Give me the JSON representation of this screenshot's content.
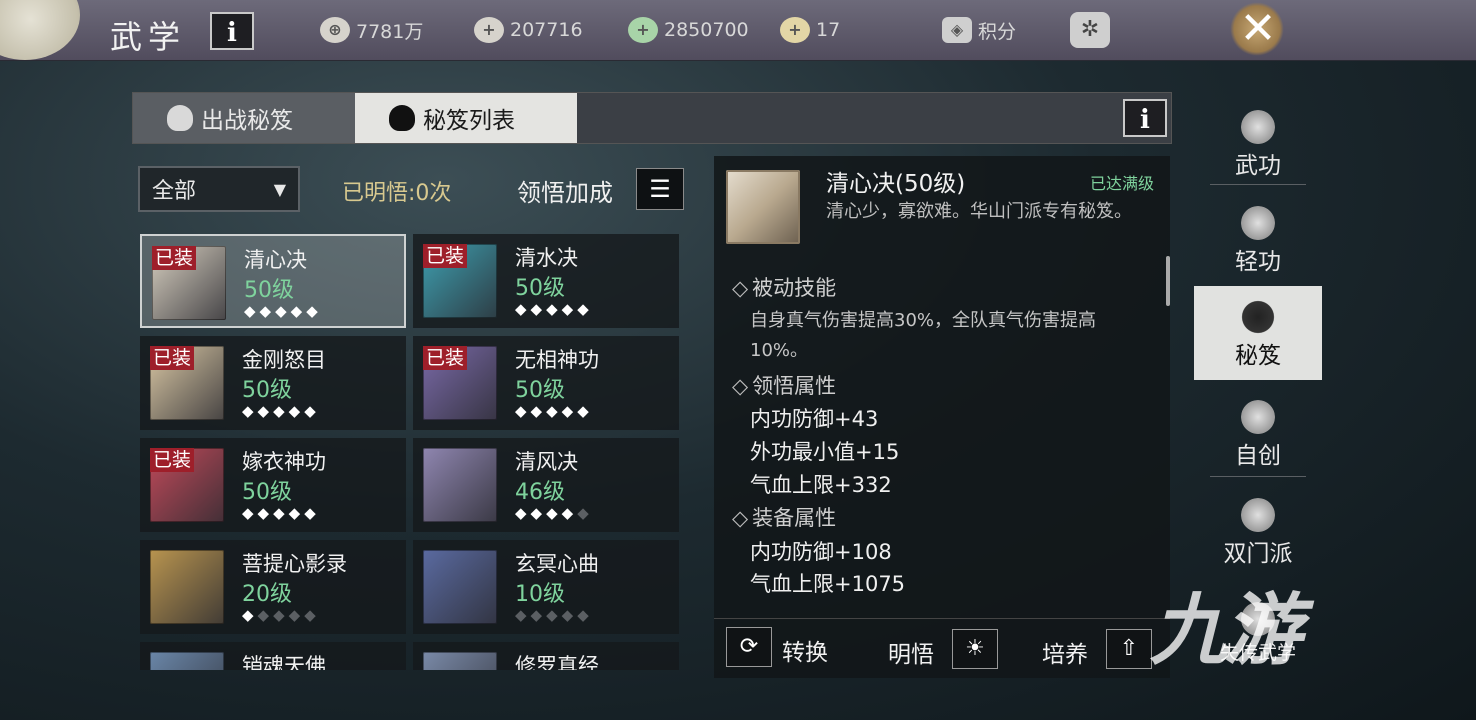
{
  "header": {
    "title": "武学",
    "resources": [
      {
        "icon": "coin-icon",
        "value": "7781万"
      },
      {
        "icon": "silver-ingot-icon",
        "value": "207716"
      },
      {
        "icon": "jade-icon",
        "value": "2850700"
      },
      {
        "icon": "gold-ingot-icon",
        "value": "17"
      }
    ],
    "points_label": "积分"
  },
  "tabs": [
    {
      "label": "出战秘笈",
      "active": false
    },
    {
      "label": "秘笈列表",
      "active": true
    }
  ],
  "filter": {
    "selected": "全部",
    "learned": "已明悟:0次",
    "bonus_label": "领悟加成"
  },
  "manuals": [
    {
      "name": "清心决",
      "level": "50级",
      "stars": 5,
      "equipped": true,
      "selected": true,
      "color": "#d7cfc0"
    },
    {
      "name": "清水决",
      "level": "50级",
      "stars": 5,
      "equipped": true,
      "selected": false,
      "color": "#3e9fb0"
    },
    {
      "name": "金刚怒目",
      "level": "50级",
      "stars": 5,
      "equipped": true,
      "selected": false,
      "color": "#d9c7a4"
    },
    {
      "name": "无相神功",
      "level": "50级",
      "stars": 5,
      "equipped": true,
      "selected": false,
      "color": "#7a6aa8"
    },
    {
      "name": "嫁衣神功",
      "level": "50级",
      "stars": 5,
      "equipped": true,
      "selected": false,
      "color": "#c14a5a"
    },
    {
      "name": "清风决",
      "level": "46级",
      "stars": 4,
      "equipped": false,
      "selected": false,
      "color": "#8f86b0"
    },
    {
      "name": "菩提心影录",
      "level": "20级",
      "stars": 1,
      "equipped": false,
      "selected": false,
      "color": "#b8944f"
    },
    {
      "name": "玄冥心曲",
      "level": "10级",
      "stars": 0,
      "equipped": false,
      "selected": false,
      "color": "#5a6aa0"
    },
    {
      "name": "销魂天佛",
      "level": "",
      "stars": 0,
      "equipped": false,
      "selected": false,
      "color": "#6a86a8"
    },
    {
      "name": "修罗真经",
      "level": "",
      "stars": 0,
      "equipped": false,
      "selected": false,
      "color": "#7a8aa8"
    }
  ],
  "equipped_label": "已装",
  "detail": {
    "name": "清心决(50级)",
    "status": "已达满级",
    "desc": "清心少，寡欲难。华山门派专有秘笈。",
    "passive_title": "被动技能",
    "passive_desc": "自身真气伤害提高30%，全队真气伤害提高10%。",
    "insight_title": "领悟属性",
    "insight_attrs": [
      "内功防御+43",
      "外功最小值+15",
      "气血上限+332"
    ],
    "equip_title": "装备属性",
    "equip_attrs": [
      "内功防御+108",
      "气血上限+1075"
    ],
    "actions": {
      "convert": "转换",
      "enlighten": "明悟",
      "train": "培养"
    }
  },
  "sidebar": [
    {
      "label": "武功",
      "icon": "martial-arts-icon",
      "active": false
    },
    {
      "label": "轻功",
      "icon": "lightness-skill-icon",
      "active": false
    },
    {
      "label": "秘笈",
      "icon": "meditation-icon",
      "active": true
    },
    {
      "label": "自创",
      "icon": "crossed-swords-icon",
      "active": false
    },
    {
      "label": "双门派",
      "icon": "dual-sect-icon",
      "active": false
    },
    {
      "label": "失传武学",
      "icon": "lost-arts-icon",
      "active": false
    }
  ],
  "watermark": "九游"
}
